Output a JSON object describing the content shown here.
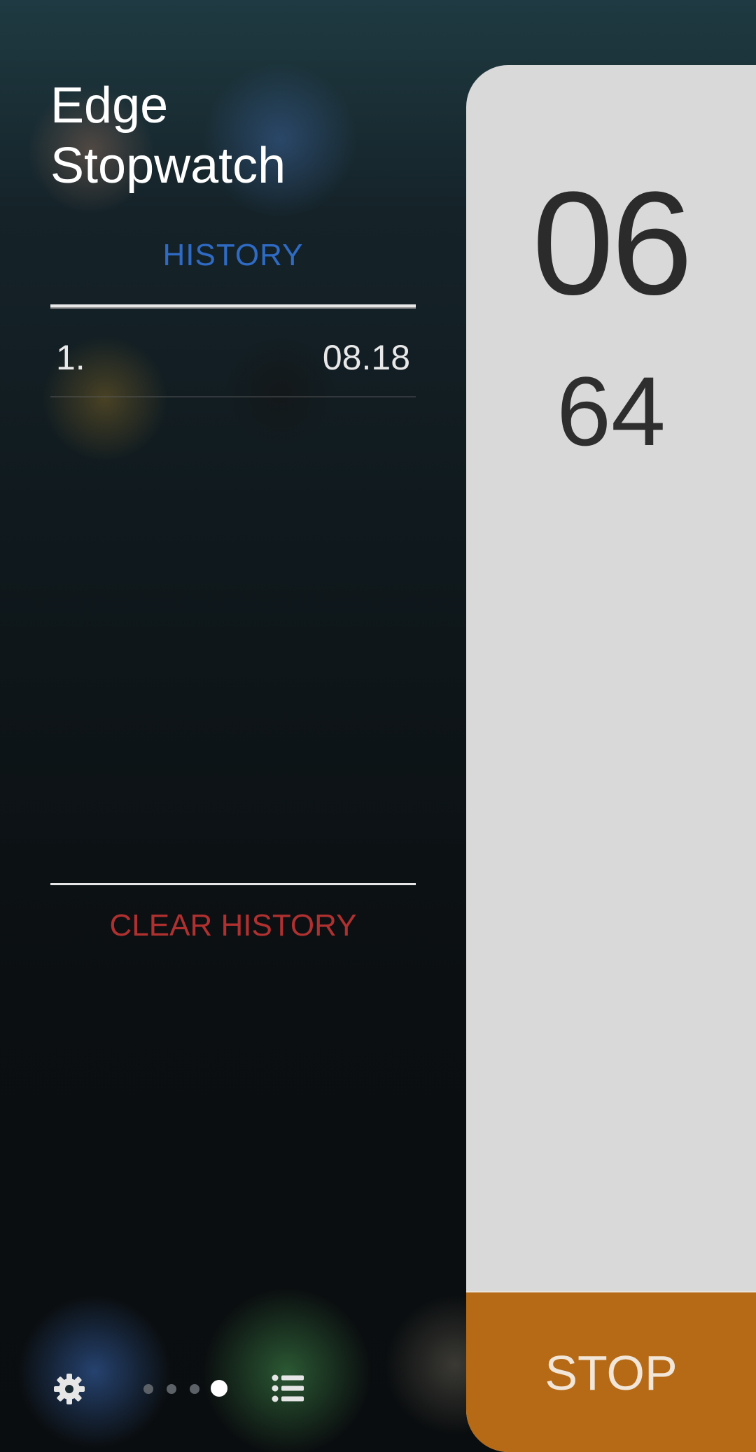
{
  "app": {
    "title": "Edge\nStopwatch"
  },
  "tabs": {
    "history_label": "HISTORY"
  },
  "history": {
    "entries": [
      {
        "index": "1.",
        "time": "08.18"
      }
    ],
    "clear_label": "CLEAR HISTORY"
  },
  "stopwatch": {
    "seconds": "06",
    "hundredths": "64",
    "stop_label": "STOP"
  },
  "bottom_bar": {
    "settings_icon": "gear-icon",
    "list_icon": "list-icon",
    "page_count": 4,
    "active_page": 4
  },
  "colors": {
    "tab_active": "#2f6bc4",
    "clear": "#b03030",
    "stop_button": "#b66a16",
    "card": "#d9d9d9"
  }
}
